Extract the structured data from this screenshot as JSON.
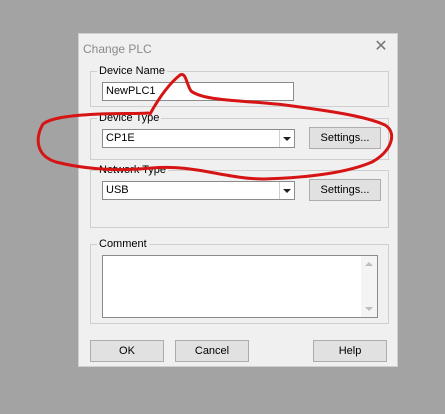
{
  "dialog": {
    "title": "Change PLC",
    "close_icon": "close-icon"
  },
  "device_name": {
    "label": "Device Name",
    "value": "NewPLC1"
  },
  "device_type": {
    "label": "Device Type",
    "value": "CP1E",
    "settings_label": "Settings..."
  },
  "network_type": {
    "label": "Network Type",
    "value": "USB",
    "settings_label": "Settings..."
  },
  "comment": {
    "label": "Comment",
    "value": ""
  },
  "buttons": {
    "ok": "OK",
    "cancel": "Cancel",
    "help": "Help"
  },
  "annotation": {
    "stroke_color": "#d61414"
  }
}
